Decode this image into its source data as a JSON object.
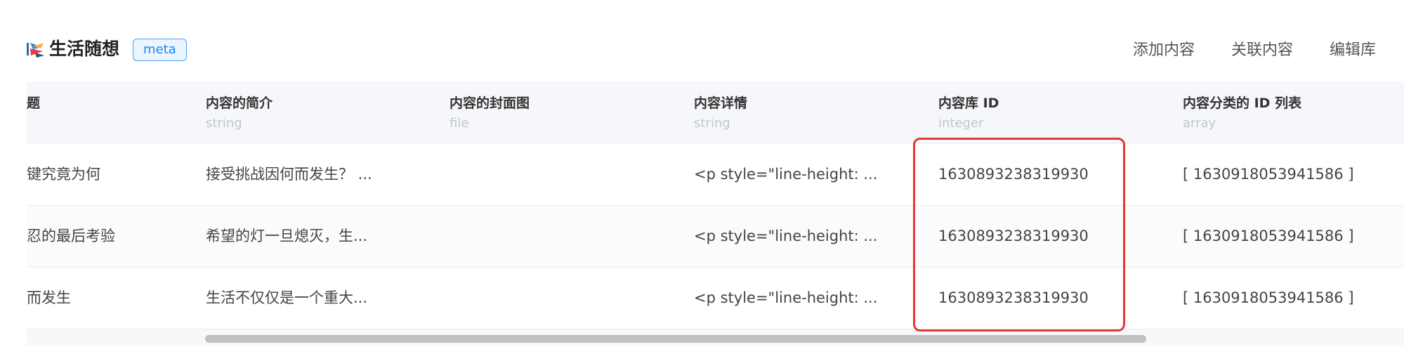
{
  "library": {
    "title": "生活随想",
    "badge": "meta",
    "logo_icon": "library-logo-icon"
  },
  "actions": [
    "添加内容",
    "关联内容",
    "编辑库"
  ],
  "columns": [
    {
      "name": "题",
      "type": ""
    },
    {
      "name": "内容的简介",
      "type": "string"
    },
    {
      "name": "内容的封面图",
      "type": "file"
    },
    {
      "name": "内容详情",
      "type": "string"
    },
    {
      "name": "内容库 ID",
      "type": "integer"
    },
    {
      "name": "内容分类的 ID 列表",
      "type": "array"
    }
  ],
  "rows": [
    [
      "键究竟为何",
      "接受挑战因何而发生？ ...",
      "",
      "<p style=\"line-height: ...",
      "1630893238319930",
      "[ 1630918053941586 ]"
    ],
    [
      "忍的最后考验",
      "希望的灯一旦熄灭，生...",
      "",
      "<p style=\"line-height: ...",
      "1630893238319930",
      "[ 1630918053941586 ]"
    ],
    [
      "而发生",
      "生活不仅仅是一个重大...",
      "",
      "<p style=\"line-height: ...",
      "1630893238319930",
      "[ 1630918053941586 ]"
    ]
  ],
  "colors": {
    "accent": "#1d86ec",
    "highlight": "#e53935",
    "header_bg": "#f5f7fa"
  }
}
